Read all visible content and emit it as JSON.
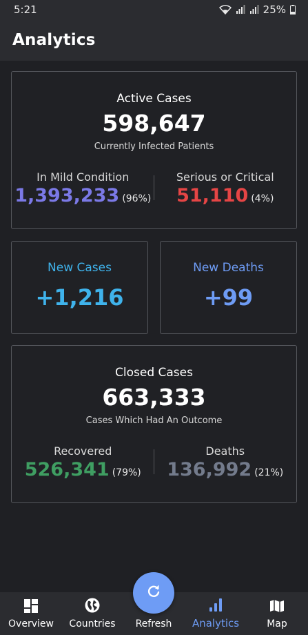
{
  "status_bar": {
    "time": "5:21",
    "battery": "25%"
  },
  "app_bar": {
    "title": "Analytics"
  },
  "active_cases": {
    "label": "Active Cases",
    "value": "598,647",
    "subtitle": "Currently Infected Patients",
    "mild": {
      "label": "In Mild Condition",
      "value": "1,393,233",
      "percent": "(96%)"
    },
    "critical": {
      "label": "Serious or Critical",
      "value": "51,110",
      "percent": "(4%)"
    }
  },
  "new_cases": {
    "label": "New Cases",
    "value": "+1,216"
  },
  "new_deaths": {
    "label": "New Deaths",
    "value": "+99"
  },
  "closed_cases": {
    "label": "Closed Cases",
    "value": "663,333",
    "subtitle": "Cases Which Had An Outcome",
    "recovered": {
      "label": "Recovered",
      "value": "526,341",
      "percent": "(79%)"
    },
    "deaths": {
      "label": "Deaths",
      "value": "136,992",
      "percent": "(21%)"
    }
  },
  "bottom_nav": {
    "items": [
      {
        "label": "Overview",
        "icon": "overview-icon"
      },
      {
        "label": "Countries",
        "icon": "globe-icon"
      },
      {
        "label": "Refresh",
        "icon": "refresh-icon"
      },
      {
        "label": "Analytics",
        "icon": "analytics-icon"
      },
      {
        "label": "Map",
        "icon": "map-icon"
      }
    ],
    "active": "Analytics"
  },
  "colors": {
    "mild": "#7b79e6",
    "critical": "#e54545",
    "new_cases": "#3fb3ec",
    "new_deaths": "#6e9cf5",
    "recovered": "#3f9e62",
    "deaths": "#737b8c",
    "accent": "#6e9cf5"
  }
}
